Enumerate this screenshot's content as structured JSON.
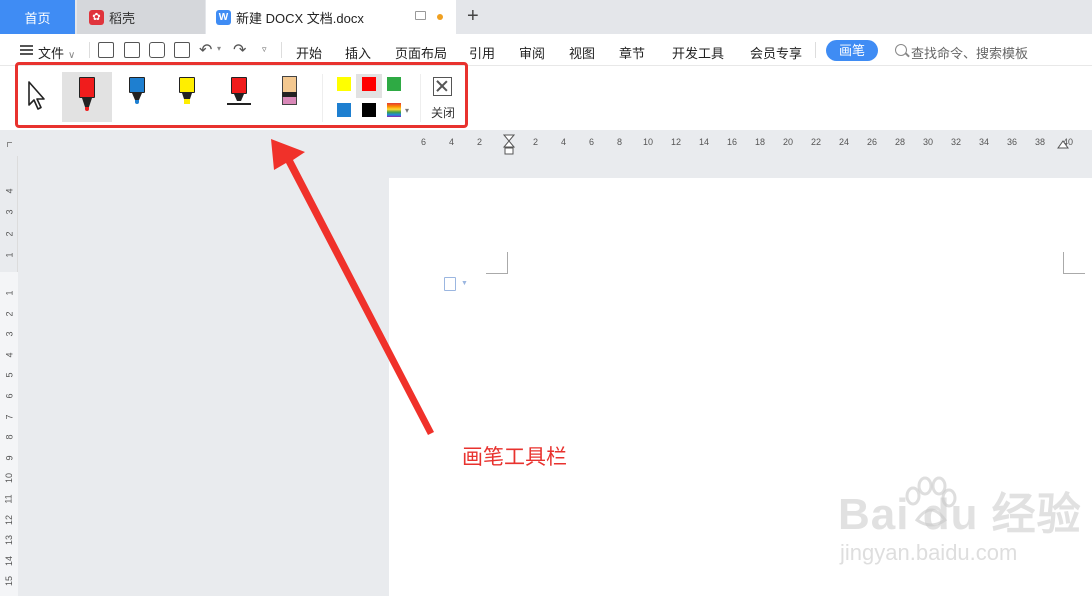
{
  "tabs": {
    "home": "首页",
    "daoke": "稻壳",
    "doc": "新建 DOCX 文档.docx",
    "daoke_logo": "daoke-logo-icon",
    "doc_logo": "w-logo"
  },
  "menu": {
    "file": "文件",
    "items": [
      "开始",
      "插入",
      "页面布局",
      "引用",
      "审阅",
      "视图",
      "章节",
      "开发工具",
      "会员专享"
    ],
    "pen": "画笔",
    "search": "查找命令、搜索模板"
  },
  "pen_toolbar": {
    "tools": [
      {
        "icon": "cursor-icon",
        "active": false
      },
      {
        "icon": "red-marker-icon",
        "active": true
      },
      {
        "icon": "blue-pen-icon",
        "active": false
      },
      {
        "icon": "yellow-highlighter-icon",
        "active": false
      },
      {
        "icon": "red-underline-pen-icon",
        "active": false
      },
      {
        "icon": "eraser-icon",
        "active": false
      }
    ],
    "colors": [
      "#ffff00",
      "#ff0000",
      "#2eaa44",
      "#1e7fd0",
      "#000000",
      "multicolor"
    ],
    "selected_color": "#ff0000",
    "close": "关闭"
  },
  "ruler": {
    "horizontal": [
      "6",
      "4",
      "2",
      "2",
      "4",
      "6",
      "8",
      "10",
      "12",
      "14",
      "16",
      "18",
      "20",
      "22",
      "24",
      "26",
      "28",
      "30",
      "32",
      "34",
      "36",
      "38",
      "40"
    ],
    "vertical_top": [
      "4",
      "3",
      "2",
      "1"
    ],
    "vertical_main": [
      "1",
      "2",
      "3",
      "4",
      "5",
      "6",
      "7",
      "8",
      "9",
      "10",
      "11",
      "12",
      "13",
      "14",
      "15"
    ]
  },
  "annotation": "画笔工具栏",
  "watermark": {
    "brand": "Bai du 经验",
    "url": "jingyan.baidu.com"
  },
  "colors": {
    "accent": "#3f8cf4",
    "annotation": "#e8322e"
  }
}
